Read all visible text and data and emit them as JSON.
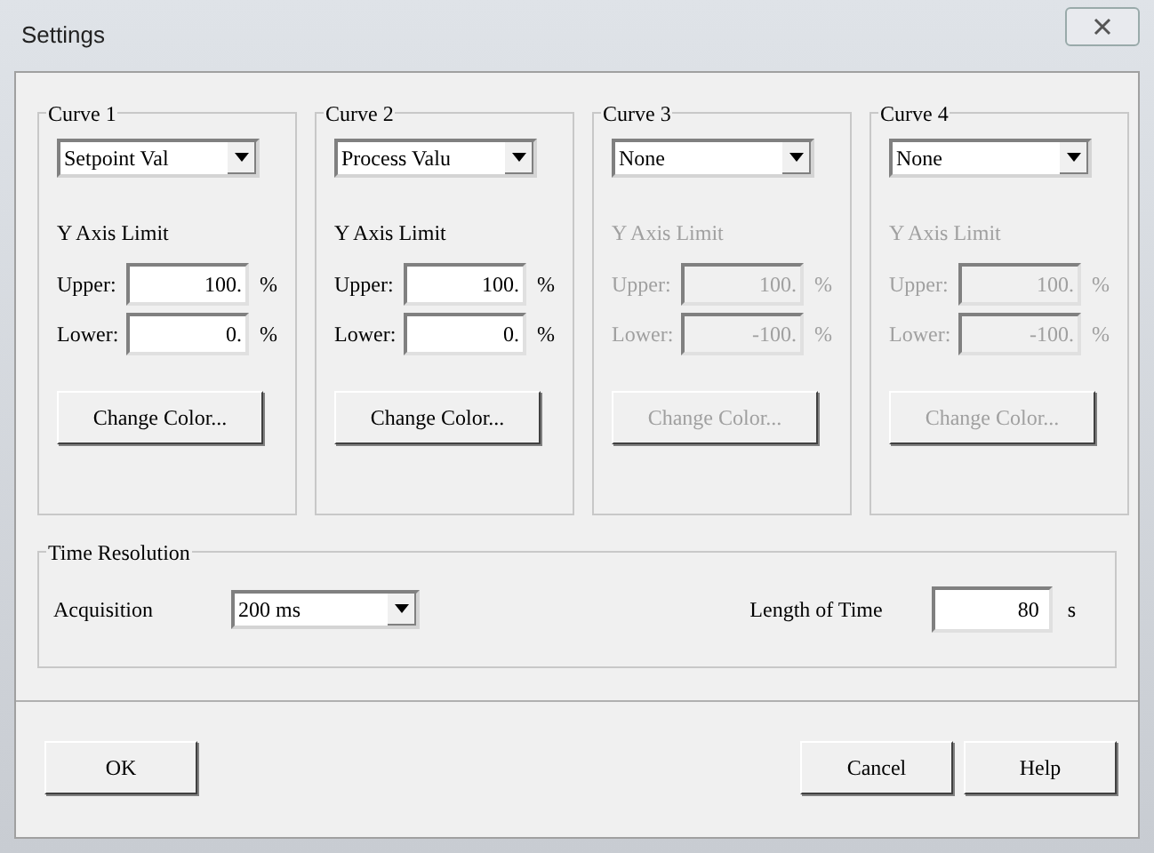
{
  "window": {
    "title": "Settings"
  },
  "curves": [
    {
      "title": "Curve 1",
      "source": "Setpoint Val",
      "disabled": false,
      "axis_label": "Y Axis Limit",
      "upper_label": "Upper:",
      "upper": "100.",
      "upper_unit": "%",
      "lower_label": "Lower:",
      "lower": "0.",
      "lower_unit": "%",
      "color_button": "Change Color..."
    },
    {
      "title": "Curve 2",
      "source": "Process Valu",
      "disabled": false,
      "axis_label": "Y Axis Limit",
      "upper_label": "Upper:",
      "upper": "100.",
      "upper_unit": "%",
      "lower_label": "Lower:",
      "lower": "0.",
      "lower_unit": "%",
      "color_button": "Change Color..."
    },
    {
      "title": "Curve 3",
      "source": "None",
      "disabled": true,
      "axis_label": "Y Axis Limit",
      "upper_label": "Upper:",
      "upper": "100.",
      "upper_unit": "%",
      "lower_label": "Lower:",
      "lower": "-100.",
      "lower_unit": "%",
      "color_button": "Change Color..."
    },
    {
      "title": "Curve 4",
      "source": "None",
      "disabled": true,
      "axis_label": "Y Axis Limit",
      "upper_label": "Upper:",
      "upper": "100.",
      "upper_unit": "%",
      "lower_label": "Lower:",
      "lower": "-100.",
      "lower_unit": "%",
      "color_button": "Change Color..."
    }
  ],
  "time_resolution": {
    "title": "Time Resolution",
    "acquisition_label": "Acquisition",
    "acquisition": "200 ms",
    "length_label": "Length of Time",
    "length": "80",
    "length_unit": "s"
  },
  "buttons": [
    {
      "label": "OK",
      "kind": "left"
    },
    {
      "label": "Cancel",
      "kind": "right"
    },
    {
      "label": "Help",
      "kind": "right"
    }
  ]
}
